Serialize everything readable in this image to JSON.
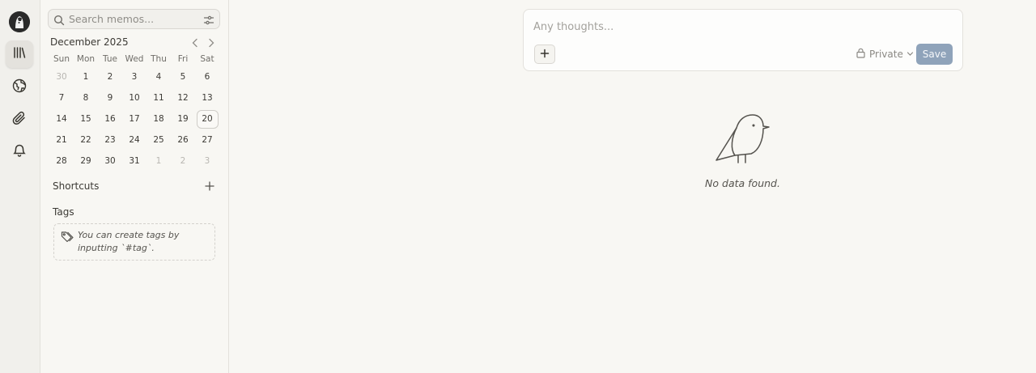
{
  "rail": {
    "items": [
      {
        "name": "memos",
        "icon": "library-icon",
        "active": true
      },
      {
        "name": "explore",
        "icon": "globe-icon",
        "active": false
      },
      {
        "name": "attachments",
        "icon": "paperclip-icon",
        "active": false
      },
      {
        "name": "inbox",
        "icon": "bell-icon",
        "active": false
      }
    ]
  },
  "sidebar": {
    "search_placeholder": "Search memos...",
    "calendar": {
      "title": "December 2025",
      "weekdays": [
        "Sun",
        "Mon",
        "Tue",
        "Wed",
        "Thu",
        "Fri",
        "Sat"
      ],
      "days": [
        {
          "d": "30",
          "m": true
        },
        {
          "d": "1"
        },
        {
          "d": "2"
        },
        {
          "d": "3"
        },
        {
          "d": "4"
        },
        {
          "d": "5"
        },
        {
          "d": "6"
        },
        {
          "d": "7"
        },
        {
          "d": "8"
        },
        {
          "d": "9"
        },
        {
          "d": "10"
        },
        {
          "d": "11"
        },
        {
          "d": "12"
        },
        {
          "d": "13"
        },
        {
          "d": "14"
        },
        {
          "d": "15"
        },
        {
          "d": "16"
        },
        {
          "d": "17"
        },
        {
          "d": "18"
        },
        {
          "d": "19"
        },
        {
          "d": "20",
          "t": true
        },
        {
          "d": "21"
        },
        {
          "d": "22"
        },
        {
          "d": "23"
        },
        {
          "d": "24"
        },
        {
          "d": "25"
        },
        {
          "d": "26"
        },
        {
          "d": "27"
        },
        {
          "d": "28"
        },
        {
          "d": "29"
        },
        {
          "d": "30"
        },
        {
          "d": "31"
        },
        {
          "d": "1",
          "m": true
        },
        {
          "d": "2",
          "m": true
        },
        {
          "d": "3",
          "m": true
        }
      ]
    },
    "shortcuts_title": "Shortcuts",
    "tags_title": "Tags",
    "tags_hint": "You can create tags by inputting `#tag`."
  },
  "editor": {
    "placeholder": "Any thoughts...",
    "add_label": "+",
    "visibility": "Private",
    "save_label": "Save"
  },
  "empty": {
    "text": "No data found."
  },
  "colors": {
    "background": "#f8f7f3",
    "rail": "#f1f0ec",
    "save_button": "#8fa3ba"
  }
}
